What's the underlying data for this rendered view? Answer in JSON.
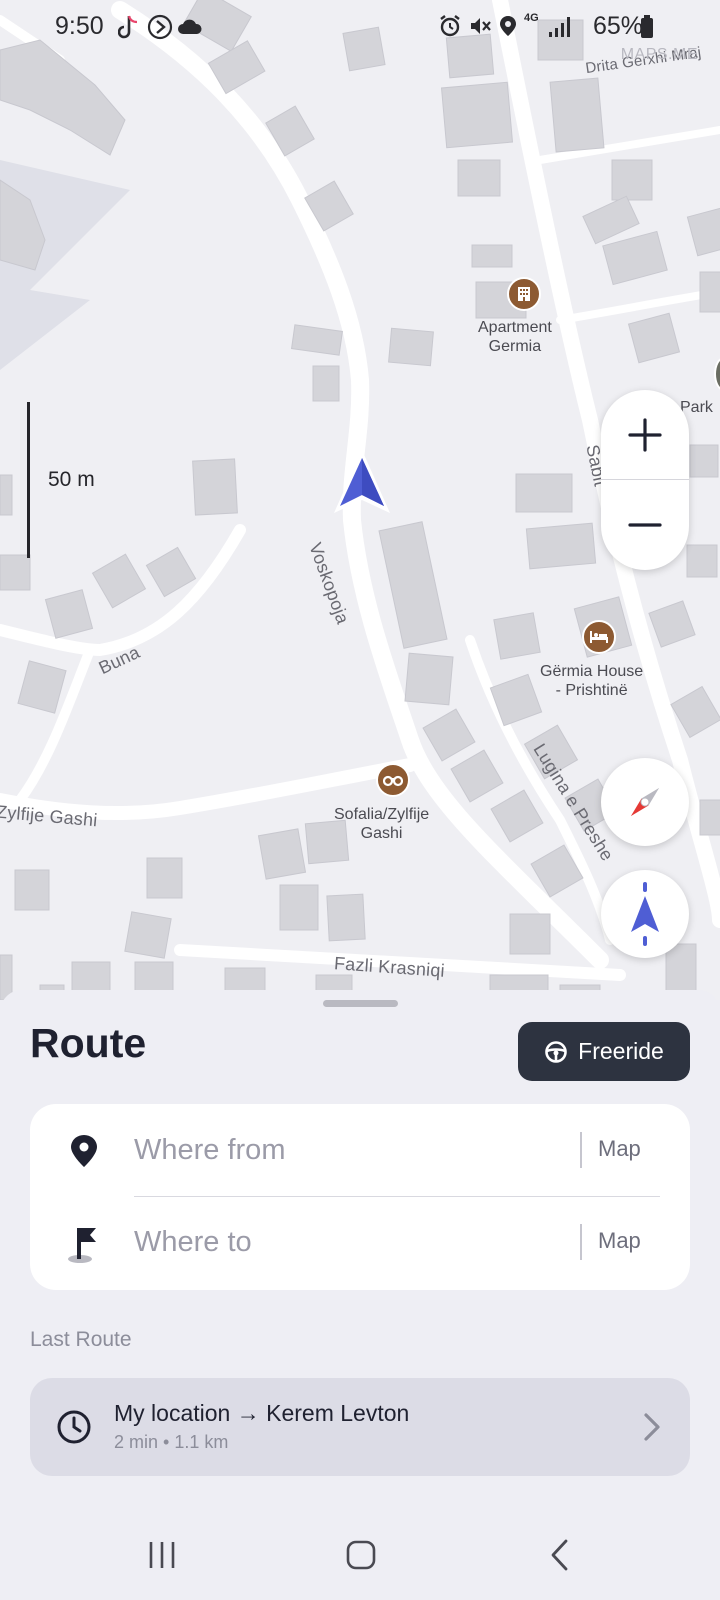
{
  "status_bar": {
    "time": "9:50",
    "battery": "65%",
    "network": "4G"
  },
  "map": {
    "attribution": "MAPS.ME",
    "scale_label": "50 m",
    "streets": {
      "drita": "Drita Gerxhi Mraj",
      "voskopoja": "Voskopoja",
      "buna": "Buna",
      "zylfije": "Zylfije Gashi",
      "fazli": "Fazli Krasniqi",
      "lugina": "Lugina e Preshe",
      "sabit": "Sabit"
    },
    "pois": {
      "apartment": "Apartment\nGermia",
      "park": "Park",
      "germia_house": "Gërmia House\n- Prishtinë",
      "sofalia": "Sofalia/Zylfije\nGashi"
    },
    "poi_color": "#8d5a32",
    "arrow_color": "#4f5ed4"
  },
  "sheet": {
    "title": "Route",
    "freeride_label": "Freeride",
    "from": {
      "placeholder": "Where from",
      "value": "",
      "map_label": "Map"
    },
    "to": {
      "placeholder": "Where to",
      "value": "",
      "map_label": "Map"
    },
    "last_route_label": "Last Route",
    "last_route": {
      "title": "My location → Kerem Levton",
      "subtitle": "2 min • 1.1 km"
    }
  },
  "icons": {
    "freeride": "steering-wheel-icon",
    "from": "location-pin-icon",
    "to": "flag-icon",
    "last_route": "clock-icon",
    "zoom_in": "plus-icon",
    "zoom_out": "minus-icon",
    "compass": "compass-icon",
    "location": "navigation-arrow-icon"
  }
}
